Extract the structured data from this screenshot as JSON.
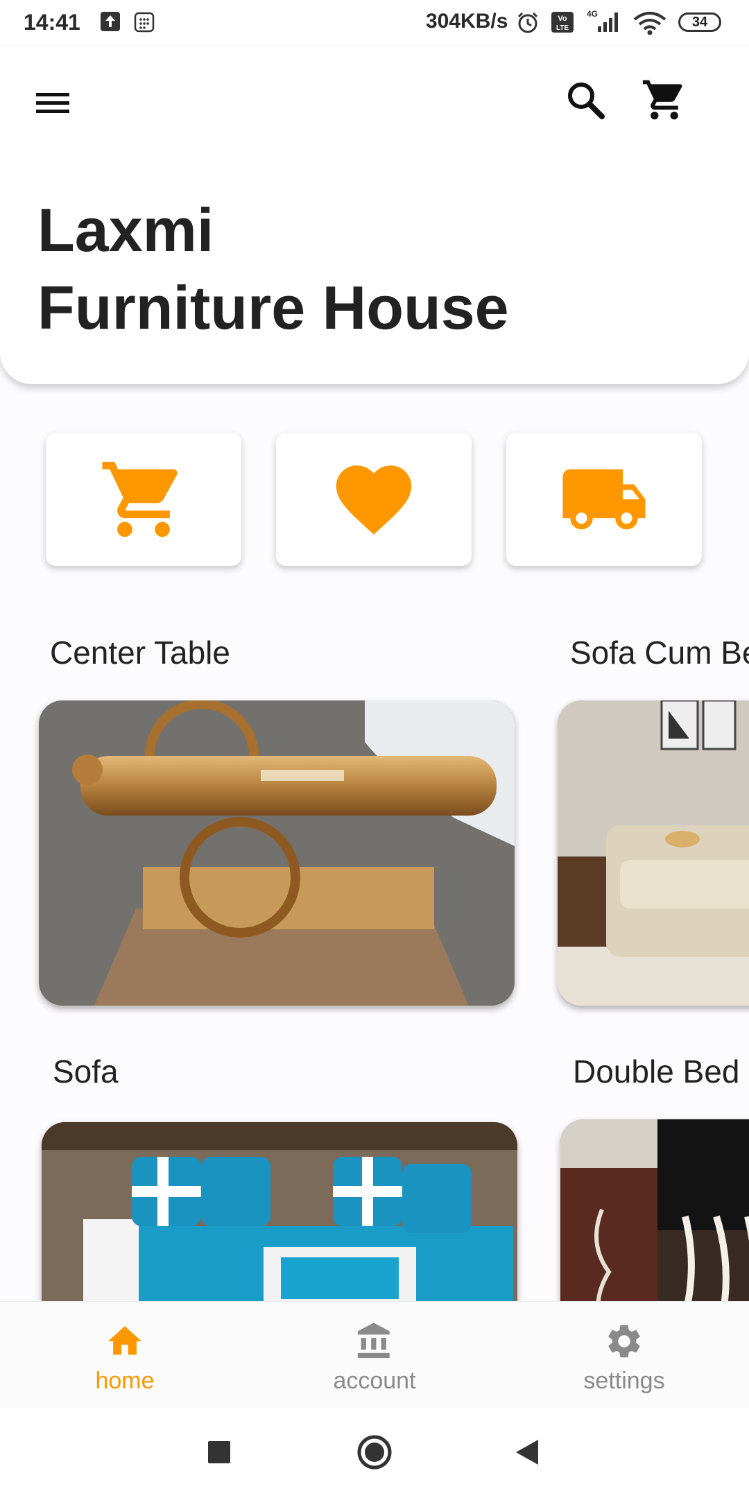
{
  "status_bar": {
    "time": "14:41",
    "network_speed": "304KB/s",
    "network_type": "4G",
    "battery": "34"
  },
  "header": {
    "title_line1": "Laxmi",
    "title_line2": "Furniture House",
    "icons": [
      "menu-icon",
      "search-icon",
      "cart-icon"
    ]
  },
  "quick_actions": [
    {
      "icon": "cart-icon"
    },
    {
      "icon": "heart-icon"
    },
    {
      "icon": "truck-icon"
    }
  ],
  "categories": [
    {
      "label": "Center Table"
    },
    {
      "label": "Sofa Cum Bed"
    },
    {
      "label": "Sofa"
    },
    {
      "label": "Double Bed"
    }
  ],
  "bottom_nav": {
    "items": [
      {
        "label": "home",
        "icon": "home-icon",
        "active": true
      },
      {
        "label": "account",
        "icon": "bank-icon",
        "active": false
      },
      {
        "label": "settings",
        "icon": "gear-icon",
        "active": false
      }
    ]
  },
  "colors": {
    "accent": "#ff9800",
    "inactive": "#8a8a8a",
    "text": "#222222"
  }
}
